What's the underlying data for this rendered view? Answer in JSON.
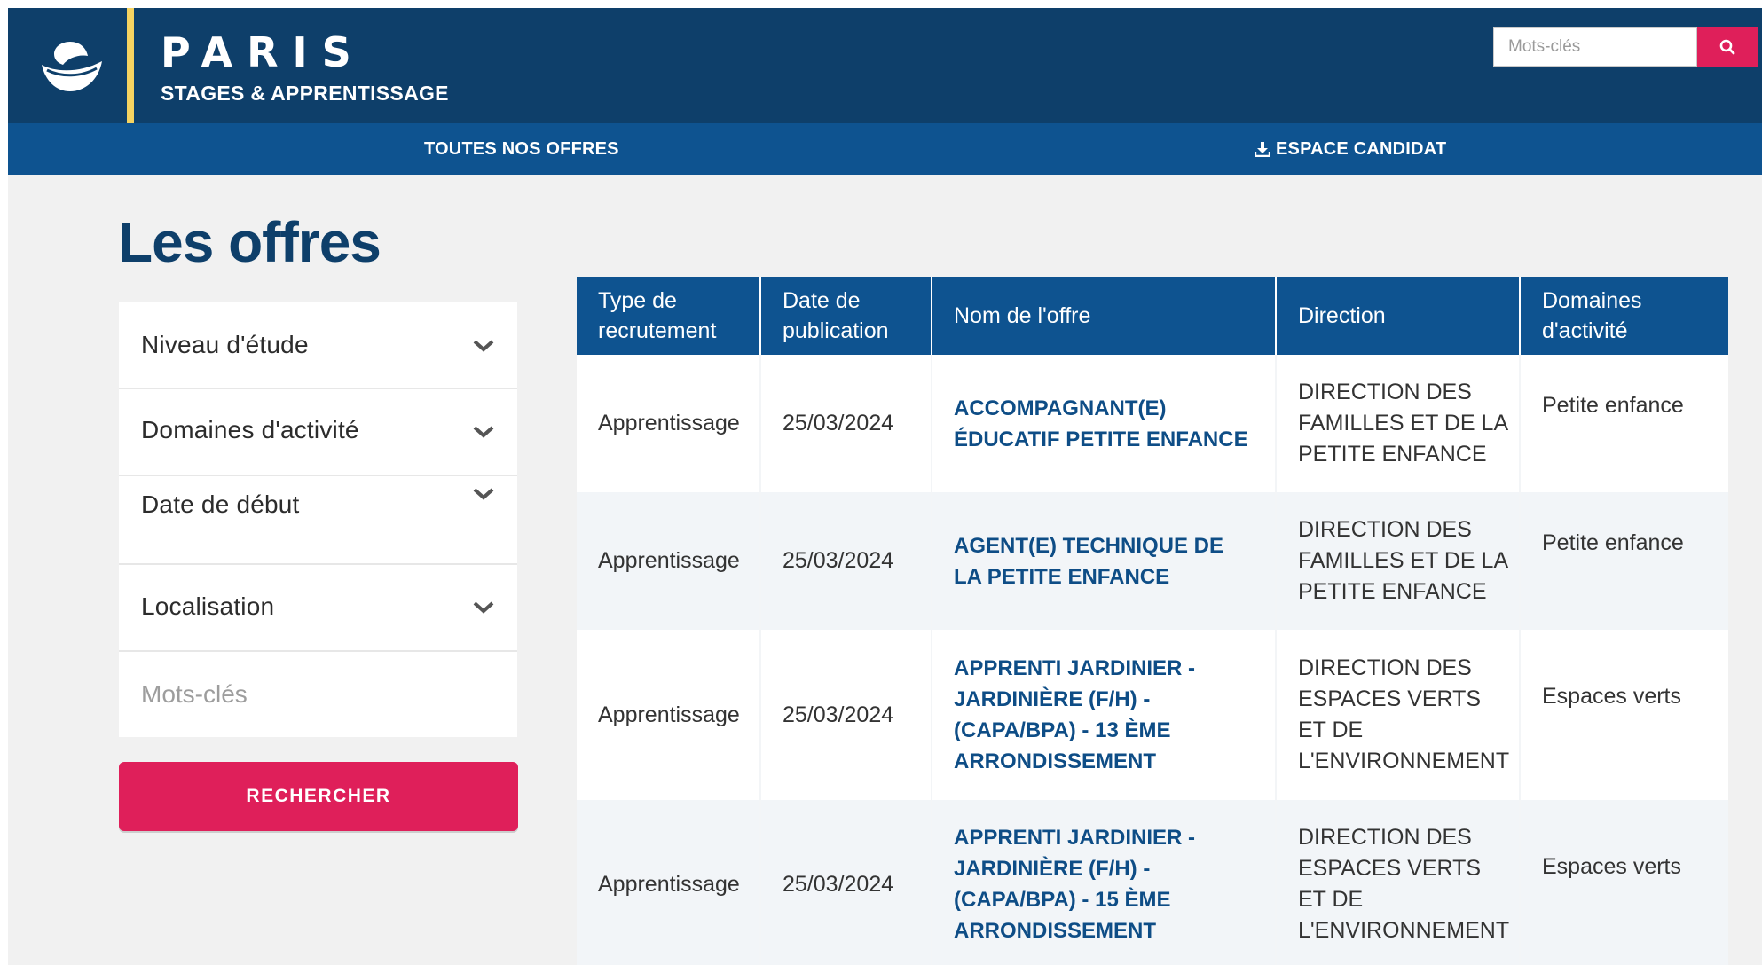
{
  "header": {
    "brand_title": "PARIS",
    "brand_subtitle": "STAGES & APPRENTISSAGE",
    "logo_icon": "paris-boat-logo",
    "search_placeholder": "Mots-clés",
    "search_icon": "search-icon"
  },
  "nav": {
    "offers_label": "TOUTES NOS OFFRES",
    "candidate_label": "ESPACE CANDIDAT",
    "candidate_icon": "download-icon"
  },
  "page_title": "Les offres",
  "filters": {
    "study_level": "Niveau d'étude",
    "activity_domains": "Domaines d'activité",
    "start_date": "Date de début",
    "location": "Localisation",
    "keywords_placeholder": "Mots-clés",
    "search_button": "RECHERCHER"
  },
  "table": {
    "headers": {
      "type": "Type de recrutement",
      "date": "Date de publication",
      "name": "Nom de l'offre",
      "direction": "Direction",
      "domains": "Domaines d'activité"
    },
    "rows": [
      {
        "type": "Apprentissage",
        "date": "25/03/2024",
        "name": "ACCOMPAGNANT(E) ÉDUCATIF PETITE ENFANCE",
        "direction": "DIRECTION DES FAMILLES ET DE LA PETITE ENFANCE",
        "domain": "Petite enfance"
      },
      {
        "type": "Apprentissage",
        "date": "25/03/2024",
        "name": "AGENT(E) TECHNIQUE DE LA PETITE ENFANCE",
        "direction": "DIRECTION DES FAMILLES ET DE LA PETITE ENFANCE",
        "domain": "Petite enfance"
      },
      {
        "type": "Apprentissage",
        "date": "25/03/2024",
        "name": "APPRENTI JARDINIER - JARDINIÈRE (F/H) - (CAPA/BPA) - 13 ÈME ARRONDISSEMENT",
        "direction": "DIRECTION DES ESPACES VERTS ET DE L'ENVIRONNEMENT",
        "domain": "Espaces verts"
      },
      {
        "type": "Apprentissage",
        "date": "25/03/2024",
        "name": "APPRENTI JARDINIER - JARDINIÈRE (F/H) - (CAPA/BPA) - 15 ÈME ARRONDISSEMENT",
        "direction": "DIRECTION DES ESPACES VERTS ET DE L'ENVIRONNEMENT",
        "domain": "Espaces verts"
      }
    ]
  },
  "colors": {
    "header_dark_blue": "#0e3f6a",
    "nav_blue": "#0e5390",
    "accent_yellow": "#f5d361",
    "accent_pink": "#df1f5a",
    "page_background": "#f1f1f1"
  }
}
